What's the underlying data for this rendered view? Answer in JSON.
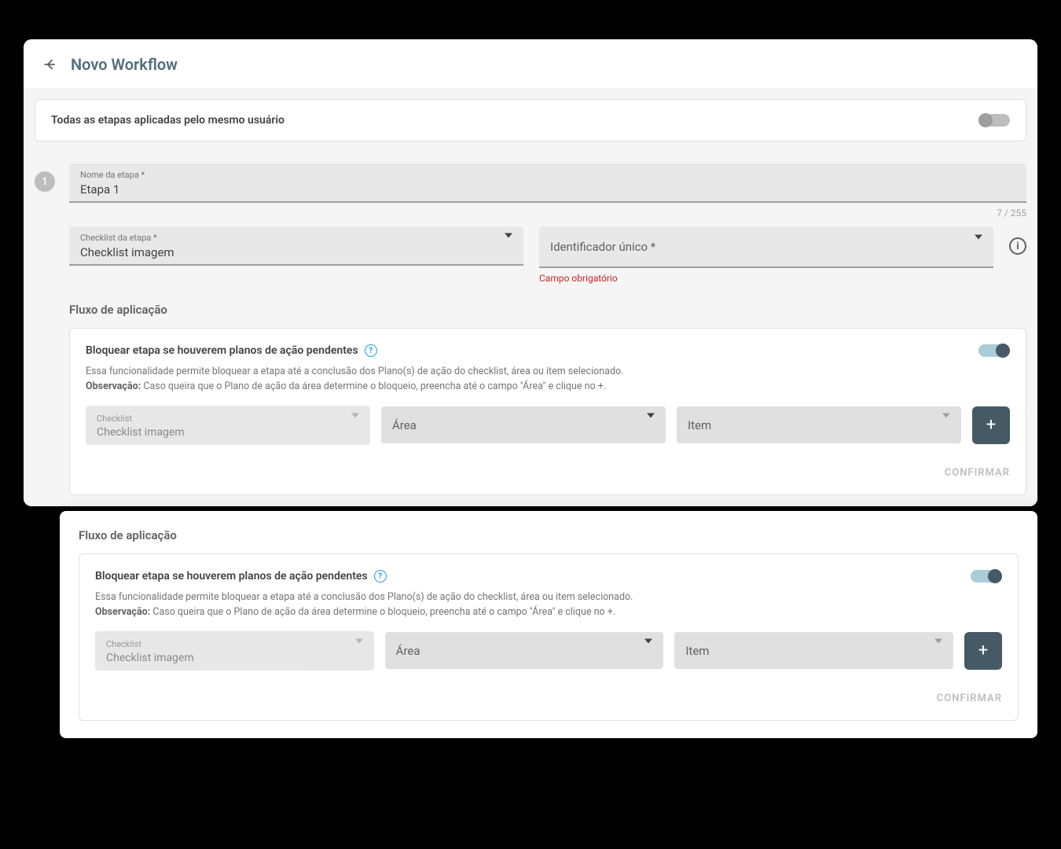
{
  "header": {
    "title": "Novo Workflow"
  },
  "setting": {
    "label": "Todas as etapas aplicadas pelo mesmo usuário"
  },
  "step": {
    "number": "1",
    "name_label": "Nome da etapa *",
    "name_value": "Etapa 1",
    "char_count": "7 / 255",
    "checklist_label": "Checklist da etapa *",
    "checklist_value": "Checklist imagem",
    "identifier_label": "Identificador único *",
    "identifier_error": "Campo obrigatório"
  },
  "flow": {
    "section_title": "Fluxo de aplicação",
    "block_title": "Bloquear etapa se houverem planos de ação pendentes",
    "desc_line": "Essa funcionalidade permite bloquear a etapa até a conclusão dos Plano(s) de ação do checklist, área ou item selecionado.",
    "obs_label": "Observação:",
    "obs_text": " Caso queira que o Plano de ação da área determine o bloqueio, preencha até o campo \"Área\" e clique no +.",
    "checklist_mini_label": "Checklist",
    "checklist_value": "Checklist imagem",
    "area_placeholder": "Área",
    "item_placeholder": "Item",
    "confirm_label": "CONFIRMAR"
  }
}
